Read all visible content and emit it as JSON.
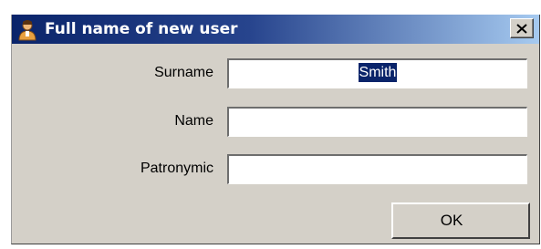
{
  "window": {
    "title": "Full name of new user",
    "icon": "user-icon",
    "close_icon": "close-icon"
  },
  "form": {
    "surname_label": "Surname",
    "surname_value": "Smith",
    "name_label": "Name",
    "name_value": "",
    "patronymic_label": "Patronymic",
    "patronymic_value": ""
  },
  "buttons": {
    "ok_label": "OK"
  },
  "colors": {
    "titlebar_start": "#0a246a",
    "titlebar_end": "#a6caf0",
    "dialog_face": "#d4d0c8",
    "selection": "#0a246a"
  }
}
